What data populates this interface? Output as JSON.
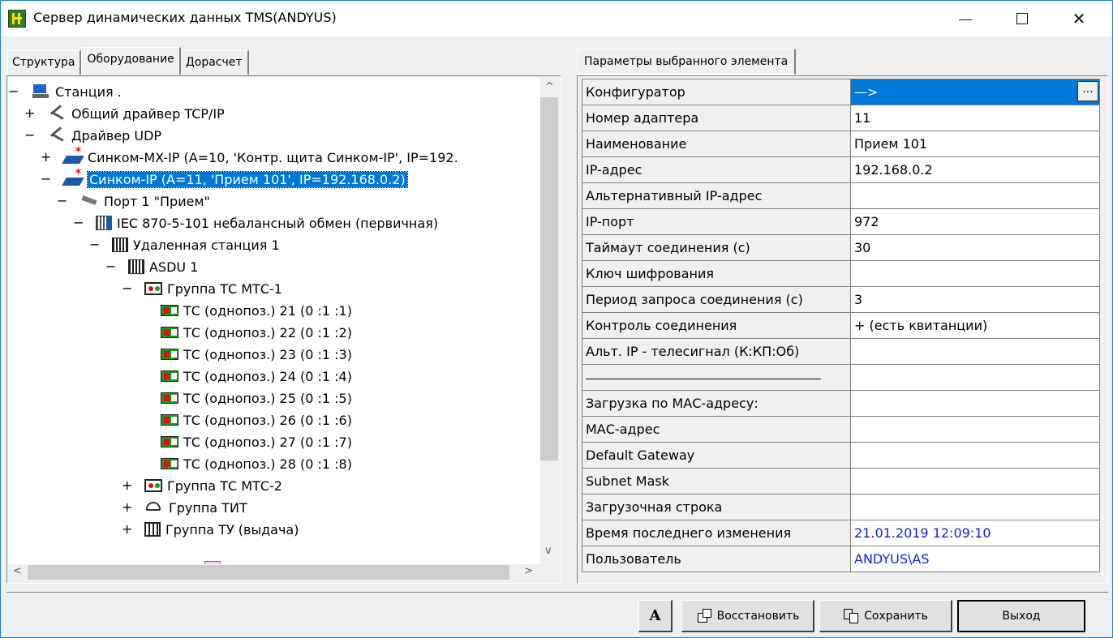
{
  "window": {
    "title": "Сервер динамических данных TMS(ANDYUS)",
    "minimize_glyph": "—",
    "close_glyph": "✕"
  },
  "left_tabs": [
    "Структура",
    "Оборудование",
    "Дорасчет"
  ],
  "right_tab": "Параметры выбранного элемента",
  "tree": [
    {
      "label": "Станция .",
      "icon": "computer-icon",
      "exp": "−"
    },
    {
      "label": "Общий драйвер TCP/IP",
      "icon": "driver-icon",
      "exp": "+"
    },
    {
      "label": "Драйвер UDP",
      "icon": "driver-icon",
      "exp": "−"
    },
    {
      "label": "Синком-MX-IP  (A=10, 'Контр. щита Синком-IP', IP=192.",
      "icon": "device-icon",
      "exp": "+"
    },
    {
      "label": "Синком-IP  (A=11, 'Прием 101', IP=192.168.0.2)",
      "icon": "device-icon",
      "exp": "−",
      "selected": true
    },
    {
      "label": "Порт 1  \"Прием\"",
      "icon": "port-icon",
      "exp": "−"
    },
    {
      "label": "IEC 870-5-101 небалансный обмен (первичная)",
      "icon": "protocol-icon",
      "exp": "−"
    },
    {
      "label": "Удаленная станция 1",
      "icon": "station-icon",
      "exp": "−"
    },
    {
      "label": "ASDU 1",
      "icon": "asdu-icon",
      "exp": "−"
    },
    {
      "label": "Группа ТС МТС-1",
      "icon": "group-ts-icon",
      "exp": "−"
    },
    {
      "label": "ТС (однопоз.)  21 (0 :1 :1)",
      "icon": "ts-icon",
      "exp": ""
    },
    {
      "label": "ТС (однопоз.)  22 (0 :1 :2)",
      "icon": "ts-icon",
      "exp": ""
    },
    {
      "label": "ТС (однопоз.)  23 (0 :1 :3)",
      "icon": "ts-icon",
      "exp": ""
    },
    {
      "label": "ТС (однопоз.)  24 (0 :1 :4)",
      "icon": "ts-icon",
      "exp": ""
    },
    {
      "label": "ТС (однопоз.)  25 (0 :1 :5)",
      "icon": "ts-icon",
      "exp": ""
    },
    {
      "label": "ТС (однопоз.)  26 (0 :1 :6)",
      "icon": "ts-icon",
      "exp": ""
    },
    {
      "label": "ТС (однопоз.)  27 (0 :1 :7)",
      "icon": "ts-icon",
      "exp": ""
    },
    {
      "label": "ТС (однопоз.)  28 (0 :1 :8)",
      "icon": "ts-icon",
      "exp": ""
    },
    {
      "label": "Группа ТС МТС-2",
      "icon": "group-ts-icon",
      "exp": "+"
    },
    {
      "label": "Группа ТИТ",
      "icon": "group-tit-icon",
      "exp": "+"
    },
    {
      "label": "Группа ТУ (выдача)",
      "icon": "group-tu-icon",
      "exp": "+"
    }
  ],
  "props": [
    {
      "key": "Конфигуратор",
      "value": "—>",
      "selected": true
    },
    {
      "key": "Номер адаптера",
      "value": "11"
    },
    {
      "key": "Наименование",
      "value": "Прием 101"
    },
    {
      "key": "IP-адрес",
      "value": "192.168.0.2"
    },
    {
      "key": "Альтернативный IP-адрес",
      "value": ""
    },
    {
      "key": "IP-порт",
      "value": "972"
    },
    {
      "key": "Таймаут соединения (с)",
      "value": "30"
    },
    {
      "key": "Ключ шифрования",
      "value": ""
    },
    {
      "key": "Период запроса соединения (с)",
      "value": "3"
    },
    {
      "key": "Контроль соединения",
      "value": "+ (есть квитанции)"
    },
    {
      "key": "Альт. IP - телесигнал (К:КП:Об)",
      "value": ""
    },
    {
      "key": "",
      "value": "",
      "separator": true
    },
    {
      "key": "Загрузка по МАС-адресу:",
      "value": ""
    },
    {
      "key": "МАС-адрес",
      "value": ""
    },
    {
      "key": "Default Gateway",
      "value": ""
    },
    {
      "key": "Subnet Mask",
      "value": ""
    },
    {
      "key": "Загрузочная строка",
      "value": ""
    },
    {
      "key": "Время последнего изменения",
      "value": "21.01.2019 12:09:10",
      "blue": true
    },
    {
      "key": "Пользователь",
      "value": "ANDYUS\\AS",
      "blue": true
    }
  ],
  "config_button": "...",
  "buttons": {
    "font": "A",
    "restore": "Восстановить",
    "save": "Сохранить",
    "exit": "Выход"
  },
  "scroll_arrows": {
    "up": "^",
    "down": "v",
    "left": "<",
    "right": ">"
  }
}
